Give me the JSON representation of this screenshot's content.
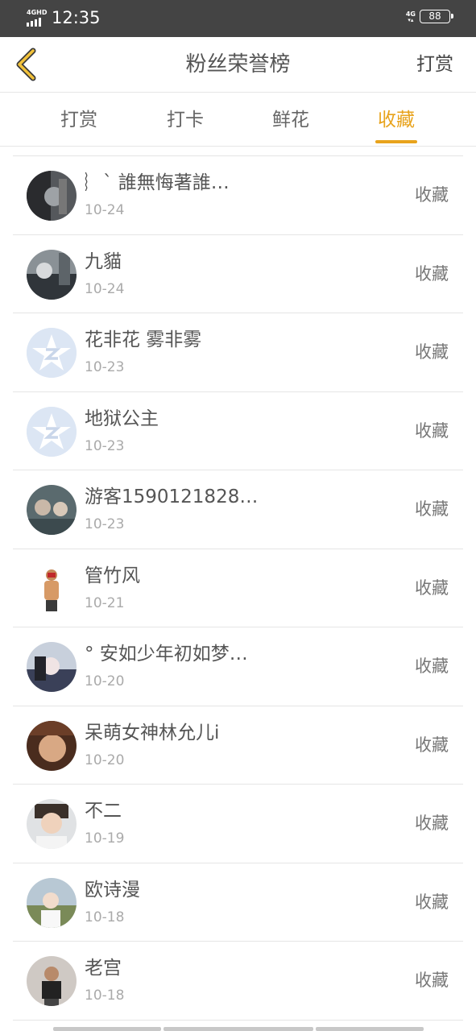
{
  "status_bar": {
    "signal_tag": "4GHD",
    "time": "12:35",
    "network_tag_top": "4G",
    "battery": "88"
  },
  "nav": {
    "title": "粉丝荣誉榜",
    "action": "打赏"
  },
  "tabs": [
    {
      "label": "打赏",
      "active": false
    },
    {
      "label": "打卡",
      "active": false
    },
    {
      "label": "鲜花",
      "active": false
    },
    {
      "label": "收藏",
      "active": true
    }
  ],
  "accent_color": "#e8a31c",
  "fans": [
    {
      "name": "︴` 誰無悔著誰…",
      "date": "10-24",
      "action": "收藏",
      "avatar": "photo"
    },
    {
      "name": "九貓",
      "date": "10-24",
      "action": "收藏",
      "avatar": "photo"
    },
    {
      "name": "花非花 雾非雾",
      "date": "10-23",
      "action": "收藏",
      "avatar": "default"
    },
    {
      "name": "地狱公主",
      "date": "10-23",
      "action": "收藏",
      "avatar": "default"
    },
    {
      "name": "游客1590121828…",
      "date": "10-23",
      "action": "收藏",
      "avatar": "photo"
    },
    {
      "name": "管竹风",
      "date": "10-21",
      "action": "收藏",
      "avatar": "photo"
    },
    {
      "name": "° 安如少年初如梦…",
      "date": "10-20",
      "action": "收藏",
      "avatar": "photo"
    },
    {
      "name": "呆萌女神林允儿i",
      "date": "10-20",
      "action": "收藏",
      "avatar": "photo"
    },
    {
      "name": "不二",
      "date": "10-19",
      "action": "收藏",
      "avatar": "photo"
    },
    {
      "name": "欧诗漫",
      "date": "10-18",
      "action": "收藏",
      "avatar": "photo"
    },
    {
      "name": "老宫",
      "date": "10-18",
      "action": "收藏",
      "avatar": "photo"
    }
  ]
}
